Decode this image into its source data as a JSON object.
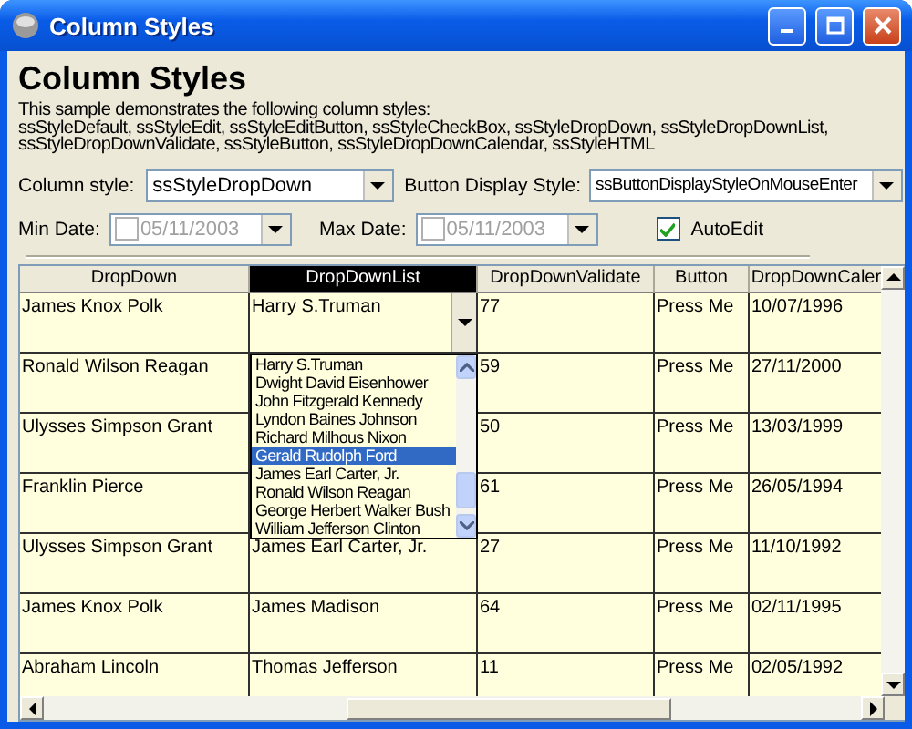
{
  "window": {
    "title": "Column Styles"
  },
  "heading": "Column Styles",
  "description": [
    "This sample demonstrates the following column styles:",
    "ssStyleDefault, ssStyleEdit, ssStyleEditButton, ssStyleCheckBox, ssStyleDropDown, ssStyleDropDownList,",
    "ssStyleDropDownValidate, ssStyleButton, ssStyleDropDownCalendar, ssStyleHTML"
  ],
  "column_style": {
    "label": "Column style:",
    "value": "ssStyleDropDown"
  },
  "button_display_style": {
    "label": "Button Display Style:",
    "value": "ssButtonDisplayStyleOnMouseEnter"
  },
  "min_date": {
    "label": "Min Date:",
    "value": "05/11/2003",
    "checked": false
  },
  "max_date": {
    "label": "Max Date:",
    "value": "05/11/2003",
    "checked": false
  },
  "auto_edit": {
    "label": "AutoEdit",
    "checked": true
  },
  "grid": {
    "columns": [
      {
        "label": "DropDown",
        "selected": false
      },
      {
        "label": "DropDownList",
        "selected": true
      },
      {
        "label": "DropDownValidate",
        "selected": false
      },
      {
        "label": "Button",
        "selected": false
      },
      {
        "label": "DropDownCaler",
        "selected": false
      }
    ],
    "rows": [
      {
        "editing": true,
        "cells": [
          "James Knox Polk",
          "Harry S.Truman",
          "77",
          "Press Me",
          "10/07/1996"
        ]
      },
      {
        "editing": false,
        "cells": [
          "Ronald Wilson Reagan",
          null,
          "59",
          "Press Me",
          "27/11/2000"
        ]
      },
      {
        "editing": false,
        "cells": [
          "Ulysses Simpson Grant",
          null,
          "50",
          "Press Me",
          "13/03/1999"
        ]
      },
      {
        "editing": false,
        "cells": [
          "Franklin Pierce",
          null,
          "61",
          "Press Me",
          "26/05/1994"
        ]
      },
      {
        "editing": false,
        "cells": [
          "Ulysses Simpson Grant",
          "James Earl Carter, Jr.",
          "27",
          "Press Me",
          "11/10/1992"
        ]
      },
      {
        "editing": false,
        "cells": [
          "James Knox Polk",
          "James Madison",
          "64",
          "Press Me",
          "02/11/1995"
        ]
      },
      {
        "editing": false,
        "cells": [
          "Abraham Lincoln",
          "Thomas Jefferson",
          "11",
          "Press Me",
          "02/05/1992"
        ]
      }
    ],
    "dropdown": {
      "items": [
        {
          "label": "Harry S.Truman",
          "selected": false
        },
        {
          "label": "Dwight David Eisenhower",
          "selected": false
        },
        {
          "label": "John Fitzgerald Kennedy",
          "selected": false
        },
        {
          "label": "Lyndon Baines Johnson",
          "selected": false
        },
        {
          "label": "Richard Milhous Nixon",
          "selected": false
        },
        {
          "label": "Gerald Rudolph Ford",
          "selected": true
        },
        {
          "label": "James Earl Carter, Jr.",
          "selected": false
        },
        {
          "label": "Ronald Wilson Reagan",
          "selected": false
        },
        {
          "label": "George Herbert Walker Bush",
          "selected": false
        },
        {
          "label": "William Jefferson Clinton",
          "selected": false
        }
      ]
    }
  }
}
